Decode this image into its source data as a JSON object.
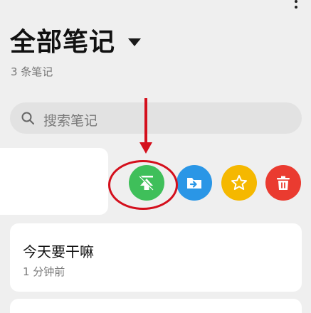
{
  "header": {
    "title": "全部笔记",
    "count_text": "3 条笔记"
  },
  "search": {
    "placeholder": "搜索笔记"
  },
  "notes": [
    {
      "title": "今天要干嘛",
      "time": "1 分钟前"
    }
  ],
  "swipe_actions": [
    {
      "icon": "pin-to-top-icon",
      "color": "#3fbf5a"
    },
    {
      "icon": "move-to-folder-icon",
      "color": "#2a96e6"
    },
    {
      "icon": "star-icon",
      "color": "#f5b800"
    },
    {
      "icon": "trash-icon",
      "color": "#ea3b30"
    }
  ],
  "annotation": {
    "color": "#d40f1c"
  }
}
